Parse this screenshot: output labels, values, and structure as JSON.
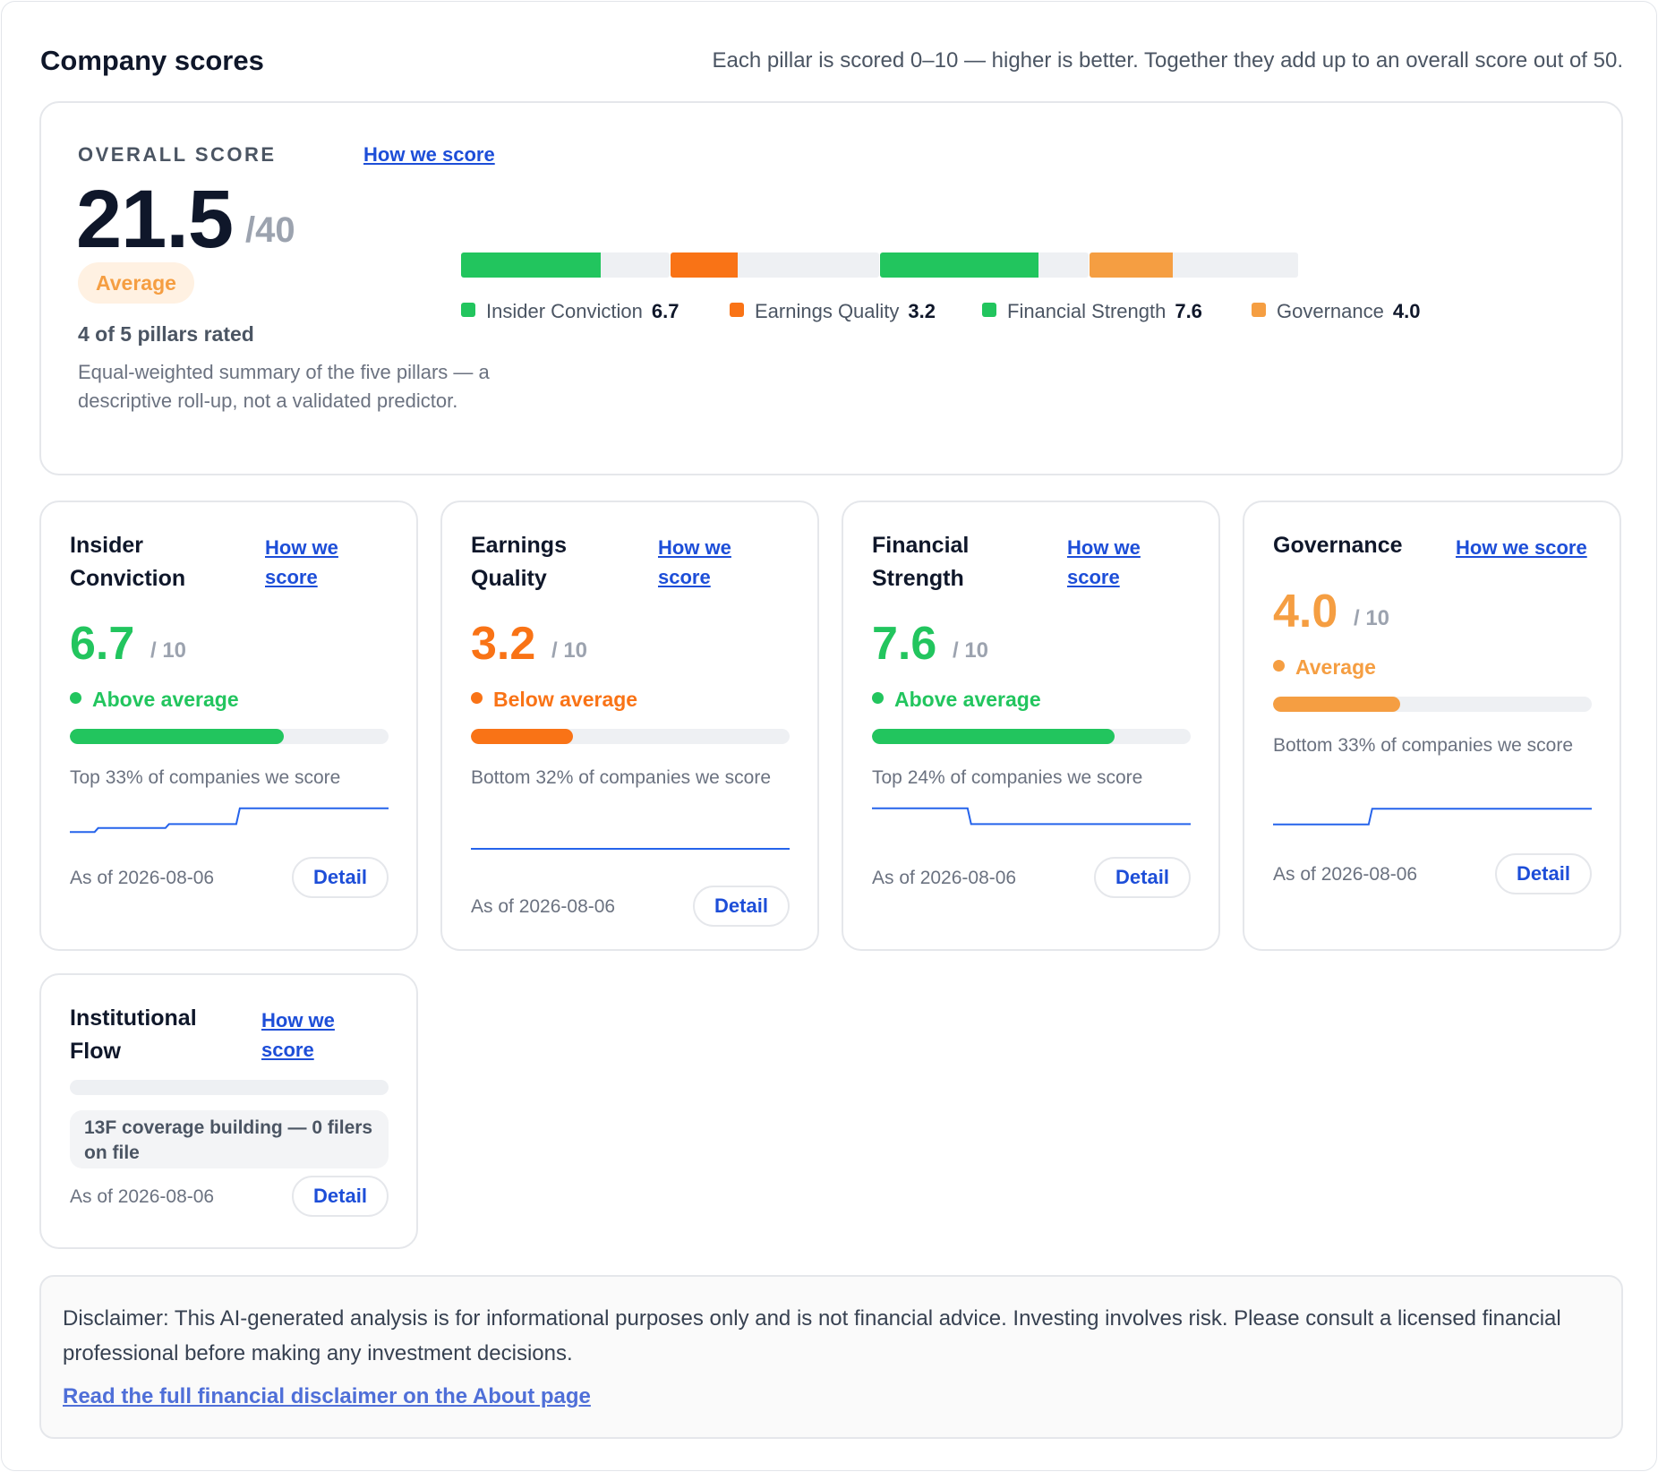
{
  "header": {
    "title": "Company scores",
    "note": "Each pillar is scored 0–10 — higher is better. Together they add up to an overall score out of 50."
  },
  "overall": {
    "label": "OVERALL SCORE",
    "how_link": "How we score",
    "score": "21.5",
    "max": "/40",
    "badge": "Average",
    "rated": "4 of 5 pillars rated",
    "description": "Equal-weighted summary of the five pillars — a descriptive roll-up, not a validated predictor.",
    "segments": [
      {
        "name": "Insider Conviction",
        "value": "6.7",
        "fill": 0.67,
        "color": "#22c55e"
      },
      {
        "name": "Earnings Quality",
        "value": "3.2",
        "fill": 0.32,
        "color": "#f97316"
      },
      {
        "name": "Financial Strength",
        "value": "7.6",
        "fill": 0.76,
        "color": "#22c55e"
      },
      {
        "name": "Governance",
        "value": "4.0",
        "fill": 0.4,
        "color": "#f59e42"
      }
    ]
  },
  "pillars": [
    {
      "title": "Insider Conviction",
      "how_link": "How we score",
      "score": "6.7",
      "max": "/ 10",
      "status": "Above average",
      "color": "#22c55e",
      "fill": 0.67,
      "percentile": "Top 33% of companies we score",
      "as_of": "As of 2026-08-06",
      "detail": "Detail",
      "spark": [
        2,
        3,
        3,
        4,
        4,
        8,
        8,
        8,
        8,
        8
      ]
    },
    {
      "title": "Earnings Quality",
      "how_link": "How we score",
      "score": "3.2",
      "max": "/ 10",
      "status": "Below average",
      "color": "#f97316",
      "fill": 0.32,
      "percentile": "Bottom 32% of companies we score",
      "as_of": "As of 2026-08-06",
      "detail": "Detail",
      "spark": [
        5,
        5,
        5,
        5,
        5,
        5,
        5,
        5,
        5,
        5
      ]
    },
    {
      "title": "Financial Strength",
      "how_link": "How we score",
      "score": "7.6",
      "max": "/ 10",
      "status": "Above average",
      "color": "#22c55e",
      "fill": 0.76,
      "percentile": "Top 24% of companies we score",
      "as_of": "As of 2026-08-06",
      "detail": "Detail",
      "spark": [
        8,
        8,
        8,
        4,
        4,
        4,
        4,
        4,
        4,
        4
      ]
    },
    {
      "title": "Governance",
      "how_link": "How we score",
      "score": "4.0",
      "max": "/ 10",
      "status": "Average",
      "color": "#f59e42",
      "fill": 0.4,
      "percentile": "Bottom 33% of companies we score",
      "as_of": "As of 2026-08-06",
      "detail": "Detail",
      "spark": [
        3,
        3,
        3,
        7,
        7,
        7,
        7,
        7,
        7,
        7
      ]
    }
  ],
  "flow": {
    "title": "Institutional Flow",
    "how_link": "How we score",
    "note": "13F coverage building — 0 filers on file",
    "as_of": "As of 2026-08-06",
    "detail": "Detail"
  },
  "disclaimer": {
    "text": "Disclaimer: This AI-generated analysis is for informational purposes only and is not financial advice. Investing involves risk. Please consult a licensed financial professional before making any investment decisions.",
    "link": "Read the full financial disclaimer on the About page"
  },
  "colors": {
    "green": "#22c55e",
    "orange": "#f97316",
    "amber": "#f59e42",
    "link": "#1d4ed8",
    "spark": "#2563eb",
    "track": "#eef0f3"
  }
}
